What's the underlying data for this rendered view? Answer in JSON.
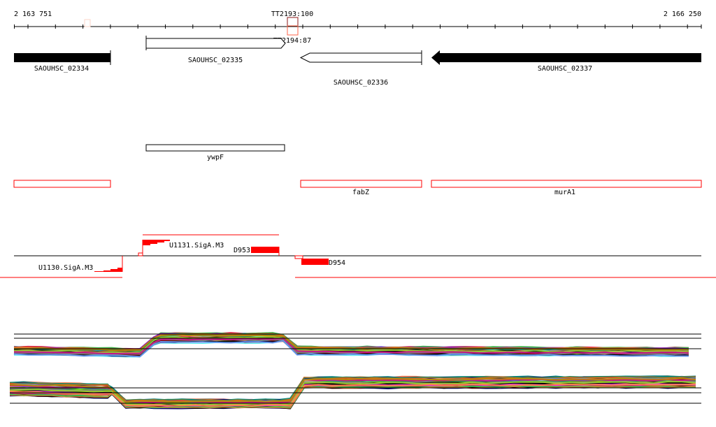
{
  "ruler": {
    "start_label": "2 163 751",
    "end_label": "2 166 250"
  },
  "terminators": [
    {
      "label": "TT2193:100",
      "color": "#8b1a1a",
      "fill2": "#ff6347"
    },
    {
      "label": "TT2194:87"
    }
  ],
  "genes": [
    {
      "label": "SAOUHSC_02334",
      "strand": "+",
      "style": "filled"
    },
    {
      "label": "SAOUHSC_02335",
      "strand": "+",
      "style": "open"
    },
    {
      "label": "SAOUHSC_02336",
      "strand": "-",
      "style": "open"
    },
    {
      "label": "SAOUHSC_02337",
      "strand": "-",
      "style": "filled"
    }
  ],
  "operon_features": [
    {
      "label": "ywpF"
    }
  ],
  "red_features": [
    {
      "label": ""
    },
    {
      "label": "fabZ"
    },
    {
      "label": "murA1"
    }
  ],
  "promoters": [
    {
      "label": "U1131.SigA.M3"
    },
    {
      "label": "U1130.SigA.M3"
    }
  ],
  "dna_features": [
    {
      "label": "D953"
    },
    {
      "label": "D954"
    }
  ],
  "colors": {
    "feature_red": "#ff0000",
    "trace_palette": [
      "#e6194b",
      "#3cb44b",
      "#4363d8",
      "#f58231",
      "#911eb4",
      "#46f0f0",
      "#f032e6",
      "#808000",
      "#008080",
      "#aa6e28",
      "#800000",
      "#000075",
      "#808080",
      "#000000",
      "#d2691e",
      "#6495ed",
      "#9acd32",
      "#ff7f50",
      "#c71585",
      "#2e8b57",
      "#b8860b",
      "#87ceeb",
      "#a0522d",
      "#7fff00"
    ]
  }
}
